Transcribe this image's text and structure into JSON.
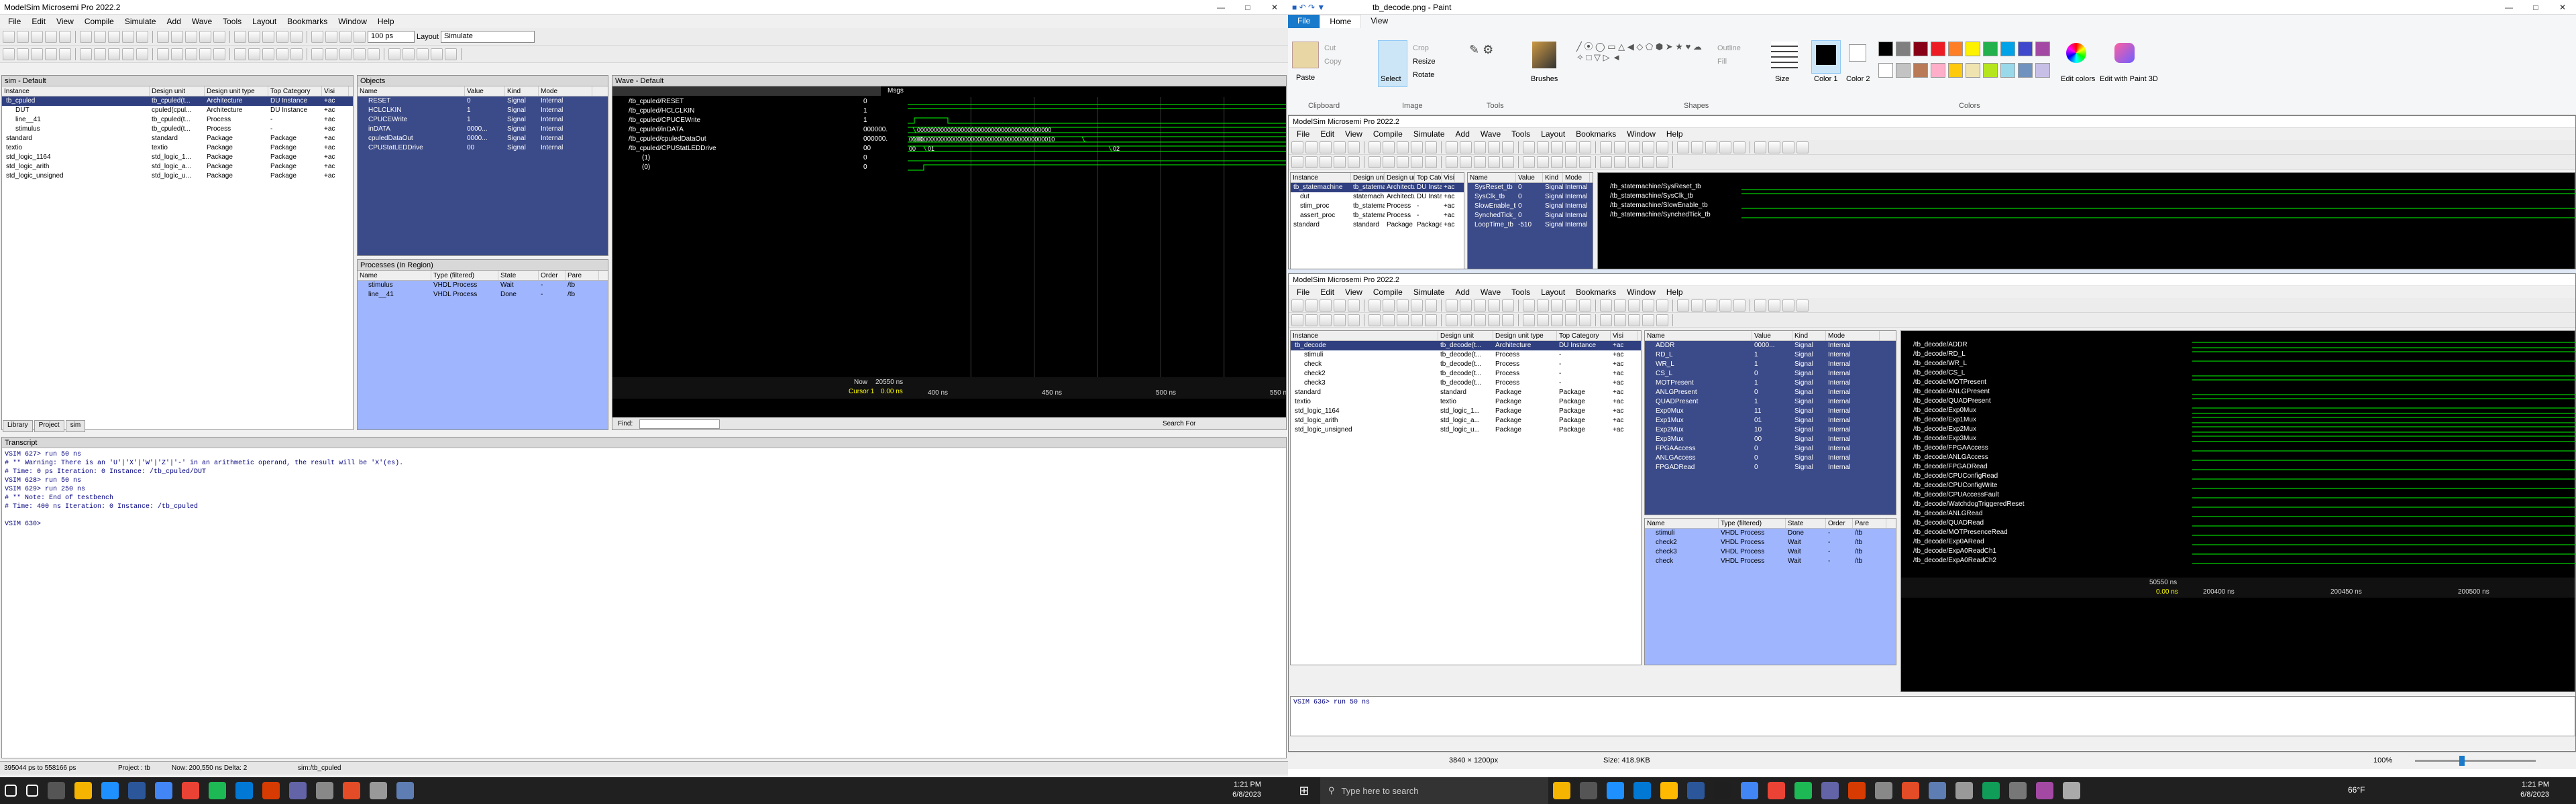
{
  "left_window": {
    "title": "ModelSim Microsemi Pro 2022.2",
    "menu": [
      "File",
      "Edit",
      "View",
      "Compile",
      "Simulate",
      "Add",
      "Wave",
      "Tools",
      "Layout",
      "Bookmarks",
      "Window",
      "Help"
    ],
    "time_value": "100 ps",
    "layout_label": "Layout",
    "layout_value": "Simulate",
    "sim_pane": {
      "title": "sim - Default",
      "columns": [
        "Instance",
        "Design unit",
        "Design unit type",
        "Top Category",
        "Visi"
      ],
      "rows": [
        [
          "tb_cpuled",
          "tb_cpuled(t...",
          "Architecture",
          "DU Instance",
          "+ac"
        ],
        [
          "DUT",
          "cpuled(cpul...",
          "Architecture",
          "DU Instance",
          "+ac"
        ],
        [
          "line__41",
          "tb_cpuled(t...",
          "Process",
          "-",
          "+ac"
        ],
        [
          "stimulus",
          "tb_cpuled(t...",
          "Process",
          "-",
          "+ac"
        ],
        [
          "standard",
          "standard",
          "Package",
          "Package",
          "+ac"
        ],
        [
          "textio",
          "textio",
          "Package",
          "Package",
          "+ac"
        ],
        [
          "std_logic_1164",
          "std_logic_1...",
          "Package",
          "Package",
          "+ac"
        ],
        [
          "std_logic_arith",
          "std_logic_a...",
          "Package",
          "Package",
          "+ac"
        ],
        [
          "std_logic_unsigned",
          "std_logic_u...",
          "Package",
          "Package",
          "+ac"
        ]
      ],
      "tabs": [
        "Library",
        "Project",
        "sim"
      ]
    },
    "objects_pane": {
      "title": "Objects",
      "columns": [
        "Name",
        "Value",
        "Kind",
        "Mode"
      ],
      "rows": [
        [
          "RESET",
          "0",
          "Signal",
          "Internal"
        ],
        [
          "HCLCLKIN",
          "1",
          "Signal",
          "Internal"
        ],
        [
          "CPUCEWrite",
          "1",
          "Signal",
          "Internal"
        ],
        [
          "inDATA",
          "0000...",
          "Signal",
          "Internal"
        ],
        [
          "cpuledDataOut",
          "0000...",
          "Signal",
          "Internal"
        ],
        [
          "CPUStatLEDDrive",
          "00",
          "Signal",
          "Internal"
        ]
      ]
    },
    "processes_pane": {
      "title": "Processes (In Region)",
      "columns": [
        "Name",
        "Type (filtered)",
        "State",
        "Order",
        "Pare"
      ],
      "rows": [
        [
          "stimulus",
          "VHDL Process",
          "Wait",
          "-",
          "/tb"
        ],
        [
          "line__41",
          "VHDL Process",
          "Done",
          "-",
          "/tb"
        ]
      ]
    },
    "wave_pane": {
      "title": "Wave - Default",
      "msgs_label": "Msgs",
      "signals": [
        [
          "/tb_cpuled/RESET",
          "0"
        ],
        [
          "/tb_cpuled/HCLCLKIN",
          "1"
        ],
        [
          "/tb_cpuled/CPUCEWrite",
          "1"
        ],
        [
          "/tb_cpuled/inDATA",
          "000000..."
        ],
        [
          "/tb_cpuled/cpuledDataOut",
          "000000..."
        ],
        [
          "/tb_cpuled/CPUStatLEDDrive",
          "00"
        ],
        [
          "(1)",
          "0"
        ],
        [
          "(0)",
          "0"
        ]
      ],
      "bus_labels": [
        "0000000000000000000000000000000000000000",
        "0000...",
        "00000000000000000000000000000000000000010",
        "00",
        "01",
        "02"
      ],
      "now_label": "Now",
      "now_value": "20550 ns",
      "cursor_label": "Cursor 1",
      "cursor_value": "0.00 ns",
      "time_ticks": [
        "400 ns",
        "450 ns",
        "500 ns",
        "550 ns"
      ],
      "find_label": "Find:",
      "search_label": "Search For"
    },
    "transcript": {
      "title": "Transcript",
      "lines": [
        "VSIM 627> run 50 ns",
        "# ** Warning: There is an 'U'|'X'|'W'|'Z'|'-' in an arithmetic operand, the result will be 'X'(es).",
        "#    Time: 0 ps  Iteration: 0  Instance: /tb_cpuled/DUT",
        "VSIM 628> run 50 ns",
        "VSIM 629> run 250 ns",
        "# ** Note: End of testbench",
        "#    Time: 400 ns  Iteration: 0  Instance: /tb_cpuled",
        "",
        "VSIM 630>"
      ]
    },
    "status": [
      "395044 ps to 558166 ps",
      "Project : tb",
      "Now: 200,550 ns  Delta: 2",
      "sim:/tb_cpuled"
    ]
  },
  "paint": {
    "title": "tb_decode.png - Paint",
    "tabs": [
      "File",
      "Home",
      "View"
    ],
    "groups": {
      "clipboard": "Clipboard",
      "paste": "Paste",
      "cut": "Cut",
      "copy": "Copy",
      "image": "Image",
      "select": "Select",
      "crop": "Crop",
      "resize": "Resize",
      "rotate": "Rotate",
      "tools": "Tools",
      "brushes": "Brushes",
      "shapes": "Shapes",
      "outline": "Outline",
      "fill": "Fill",
      "size": "Size",
      "color1": "Color 1",
      "color2": "Color 2",
      "colors": "Colors",
      "edit_colors": "Edit colors",
      "edit_paint3d": "Edit with Paint 3D"
    },
    "dimensions": "3840 × 1200px",
    "size_info": "Size: 418.9KB",
    "zoom": "100%",
    "palette": [
      "#000000",
      "#7f7f7f",
      "#880015",
      "#ed1c24",
      "#ff7f27",
      "#fff200",
      "#22b14c",
      "#00a2e8",
      "#3f48cc",
      "#a349a4",
      "#ffffff",
      "#c3c3c3",
      "#b97a57",
      "#ffaec9",
      "#ffc90e",
      "#efe4b0",
      "#b5e61d",
      "#99d9ea",
      "#7092be",
      "#c8bfe7"
    ]
  },
  "inner_top": {
    "title": "ModelSim Microsemi Pro 2022.2",
    "sim_rows": [
      [
        "tb_statemachine",
        "tb_statema...",
        "Architecture",
        "DU Instance",
        "+ac"
      ],
      [
        "dut",
        "statemach...",
        "Architecture",
        "DU Instance",
        "+ac"
      ],
      [
        "stim_proc",
        "tb_statema...",
        "Process",
        "-",
        "+ac"
      ],
      [
        "assert_proc",
        "tb_statema...",
        "Process",
        "-",
        "+ac"
      ],
      [
        "standard",
        "standard",
        "Package",
        "Package",
        "+ac"
      ]
    ],
    "obj_rows": [
      [
        "SysReset_tb",
        "0",
        "Signal",
        "Internal"
      ],
      [
        "SysClk_tb",
        "0",
        "Signal",
        "Internal"
      ],
      [
        "SlowEnable_tb",
        "0",
        "Signal",
        "Internal"
      ],
      [
        "SynchedTick_tb",
        "0",
        "Signal",
        "Internal"
      ],
      [
        "LoopTime_tb",
        "-510",
        "Signal",
        "Internal"
      ]
    ],
    "wave_rows": [
      "/tb_statemachine/SysReset_tb",
      "/tb_statemachine/SysClk_tb",
      "/tb_statemachine/SlowEnable_tb",
      "/tb_statemachine/SynchedTick_tb"
    ]
  },
  "inner_bottom": {
    "title": "ModelSim Microsemi Pro 2022.2",
    "sim_rows": [
      [
        "tb_decode",
        "tb_decode(t...",
        "Architecture",
        "DU Instance",
        "+ac"
      ],
      [
        "stimuli",
        "tb_decode(t...",
        "Process",
        "-",
        "+ac"
      ],
      [
        "check",
        "tb_decode(t...",
        "Process",
        "-",
        "+ac"
      ],
      [
        "check2",
        "tb_decode(t...",
        "Process",
        "-",
        "+ac"
      ],
      [
        "check3",
        "tb_decode(t...",
        "Process",
        "-",
        "+ac"
      ],
      [
        "standard",
        "standard",
        "Package",
        "Package",
        "+ac"
      ],
      [
        "textio",
        "textio",
        "Package",
        "Package",
        "+ac"
      ],
      [
        "std_logic_1164",
        "std_logic_1...",
        "Package",
        "Package",
        "+ac"
      ],
      [
        "std_logic_arith",
        "std_logic_a...",
        "Package",
        "Package",
        "+ac"
      ],
      [
        "std_logic_unsigned",
        "std_logic_u...",
        "Package",
        "Package",
        "+ac"
      ]
    ],
    "obj_rows": [
      [
        "ADDR",
        "0000...",
        "Signal",
        "Internal"
      ],
      [
        "RD_L",
        "1",
        "Signal",
        "Internal"
      ],
      [
        "WR_L",
        "1",
        "Signal",
        "Internal"
      ],
      [
        "CS_L",
        "0",
        "Signal",
        "Internal"
      ],
      [
        "MOTPresent",
        "1",
        "Signal",
        "Internal"
      ],
      [
        "ANLGPresent",
        "0",
        "Signal",
        "Internal"
      ],
      [
        "QUADPresent",
        "1",
        "Signal",
        "Internal"
      ],
      [
        "Exp0Mux",
        "11",
        "Signal",
        "Internal"
      ],
      [
        "Exp1Mux",
        "01",
        "Signal",
        "Internal"
      ],
      [
        "Exp2Mux",
        "10",
        "Signal",
        "Internal"
      ],
      [
        "Exp3Mux",
        "00",
        "Signal",
        "Internal"
      ],
      [
        "FPGAAccess",
        "0",
        "Signal",
        "Internal"
      ],
      [
        "ANLGAccess",
        "0",
        "Signal",
        "Internal"
      ],
      [
        "FPGADRead",
        "0",
        "Signal",
        "Internal"
      ]
    ],
    "proc_rows": [
      [
        "stimuli",
        "VHDL Process",
        "Done",
        "-",
        "/tb"
      ],
      [
        "check2",
        "VHDL Process",
        "Wait",
        "-",
        "/tb"
      ],
      [
        "check3",
        "VHDL Process",
        "Wait",
        "-",
        "/tb"
      ],
      [
        "check",
        "VHDL Process",
        "Wait",
        "-",
        "/tb"
      ]
    ],
    "wave_rows": [
      "/tb_decode/ADDR",
      "/tb_decode/RD_L",
      "/tb_decode/WR_L",
      "/tb_decode/CS_L",
      "/tb_decode/MOTPresent",
      "/tb_decode/ANLGPresent",
      "/tb_decode/QUADPresent",
      "/tb_decode/Exp0Mux",
      "/tb_decode/Exp1Mux",
      "/tb_decode/Exp2Mux",
      "/tb_decode/Exp3Mux",
      "/tb_decode/FPGAAccess",
      "/tb_decode/ANLGAccess",
      "/tb_decode/FPGADRead",
      "/tb_decode/CPUConfigRead",
      "/tb_decode/CPUConfigWrite",
      "/tb_decode/CPUAccessFault",
      "/tb_decode/WatchdogTriggeredReset",
      "/tb_decode/ANLGRead",
      "/tb_decode/QUADRead",
      "/tb_decode/MOTPresenceRead",
      "/tb_decode/Exp0ARead",
      "/tb_decode/ExpA0ReadCh1",
      "/tb_decode/ExpA0ReadCh2"
    ],
    "now_value": "50550 ns",
    "cursor_value": "0.00 ns",
    "time_ticks": [
      "200400 ns",
      "200450 ns",
      "200500 ns"
    ],
    "transcript": "VSIM 636> run 50 ns"
  },
  "taskbar_left": {
    "time": "1:21 PM",
    "date": "6/8/2023"
  },
  "taskbar_right": {
    "search_placeholder": "Type here to search",
    "weather": "66°F",
    "time": "1:21 PM",
    "date": "6/8/2023"
  }
}
